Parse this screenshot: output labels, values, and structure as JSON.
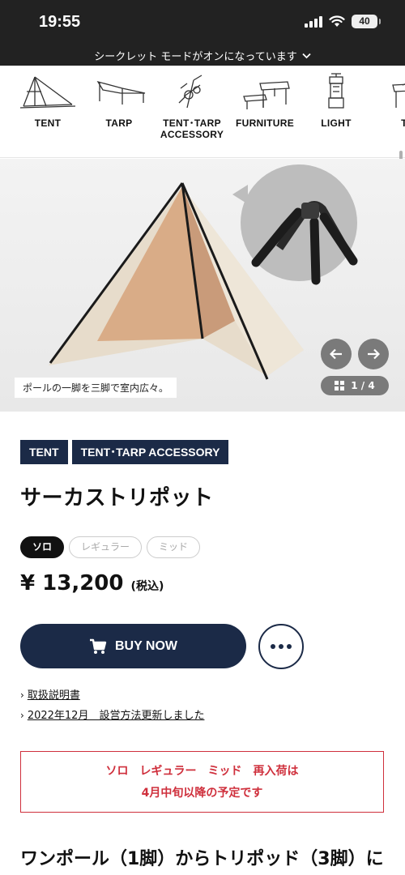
{
  "status_bar": {
    "time": "19:55",
    "battery": "40"
  },
  "incognito": {
    "text": "シークレット モードがオンになっています"
  },
  "categories": [
    {
      "label": "TENT",
      "icon": "tent-icon"
    },
    {
      "label": "TARP",
      "icon": "tarp-icon"
    },
    {
      "label": "TENT･TARP\nACCESSORY",
      "icon": "tent-accessory-icon"
    },
    {
      "label": "FURNITURE",
      "icon": "furniture-icon"
    },
    {
      "label": "LIGHT",
      "icon": "lantern-icon"
    },
    {
      "label": "TA",
      "icon": "table-icon"
    }
  ],
  "hero": {
    "caption": "ポールの一脚を三脚で室内広々。",
    "pager": "1 / 4"
  },
  "product": {
    "tags": [
      "TENT",
      "TENT･TARP ACCESSORY"
    ],
    "title": "サーカストリポット",
    "variants": [
      "ソロ",
      "レギュラー",
      "ミッド"
    ],
    "selected_variant": "ソロ",
    "price": "¥ 13,200",
    "price_tax": "(税込)",
    "buy_label": "BUY NOW",
    "links": [
      "取扱説明書",
      "2022年12月　設営方法更新しました"
    ]
  },
  "notice": {
    "line1": "ソロ　レギュラー　ミッド　再入荷は",
    "line2": "4月中旬以降の予定です"
  },
  "section_heading": "ワンポール（1脚）からトリポッド（3脚）に",
  "colors": {
    "navy": "#1b2a47",
    "notice_red": "#cf2f3c",
    "dark_bar": "#222222"
  }
}
